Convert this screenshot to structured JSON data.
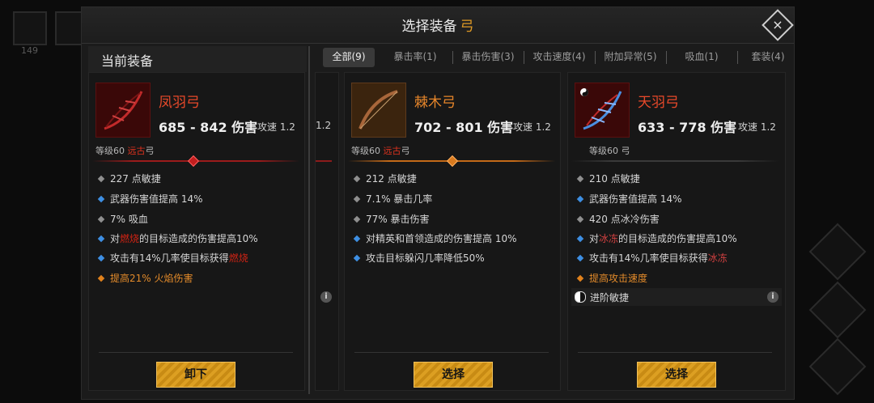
{
  "background": {
    "left_count": "149"
  },
  "header": {
    "title": "选择装备",
    "category": "弓",
    "close_glyph": "×"
  },
  "current_section": {
    "label": "当前装备"
  },
  "tabs": [
    {
      "label": "全部(9)",
      "active": true
    },
    {
      "label": "暴击率(1)"
    },
    {
      "label": "暴击伤害(3)"
    },
    {
      "label": "攻击速度(4)"
    },
    {
      "label": "附加异常(5)"
    },
    {
      "label": "吸血(1)"
    },
    {
      "label": "套装(4)"
    }
  ],
  "peek": {
    "speed": "1.2",
    "info": "i"
  },
  "cards": [
    {
      "name": "凤羽弓",
      "damage": "685 - 842 伤害",
      "speed_label": "攻速",
      "speed_value": "1.2",
      "level_prefix": "等级60",
      "rarity": "远古",
      "type": "弓",
      "attrs": [
        {
          "pre": "227 点敏捷",
          "kw": "",
          "post": ""
        },
        {
          "pre": "武器伤害值提高 14%",
          "kw": "",
          "post": ""
        },
        {
          "pre": "7% 吸血",
          "kw": "",
          "post": ""
        },
        {
          "pre": "对",
          "kw": "燃烧",
          "post": "的目标造成的伤害提高10%"
        },
        {
          "pre": "攻击有14%几率使目标获得",
          "kw": "燃烧",
          "post": ""
        },
        {
          "pre": "提高21% 火焰伤害",
          "kw": "",
          "post": ""
        }
      ],
      "button": "卸下"
    },
    {
      "name": "棘木弓",
      "damage": "702 - 801 伤害",
      "speed_label": "攻速",
      "speed_value": "1.2",
      "level_prefix": "等级60",
      "rarity": "远古",
      "type": "弓",
      "attrs": [
        {
          "pre": "212 点敏捷"
        },
        {
          "pre": "7.1% 暴击几率"
        },
        {
          "pre": "77% 暴击伤害"
        },
        {
          "pre": "对精英和首领造成的伤害提高 10%"
        },
        {
          "pre": "攻击目标躲闪几率降低50%"
        }
      ],
      "button": "选择"
    },
    {
      "name": "天羽弓",
      "damage": "633 - 778 伤害",
      "speed_label": "攻速",
      "speed_value": "1.2",
      "level_prefix": "等级60",
      "type": "弓",
      "attrs": [
        {
          "pre": "210 点敏捷",
          "kw": "",
          "post": ""
        },
        {
          "pre": "武器伤害值提高 14%",
          "kw": "",
          "post": ""
        },
        {
          "pre": "420 点冰冷伤害",
          "kw": "",
          "post": ""
        },
        {
          "pre": "对",
          "kw": "冰冻",
          "post": "的目标造成的伤害提高10%"
        },
        {
          "pre": "攻击有14%几率使目标获得",
          "kw": "冰冻",
          "post": ""
        },
        {
          "pre": "提高攻击速度",
          "kw": "",
          "post": ""
        }
      ],
      "advanced": "进阶敏捷",
      "info": "i",
      "button": "选择"
    }
  ],
  "colors": {
    "accent": "#e09a25",
    "rare_red": "#e8492a",
    "button": "#dc9f22"
  }
}
